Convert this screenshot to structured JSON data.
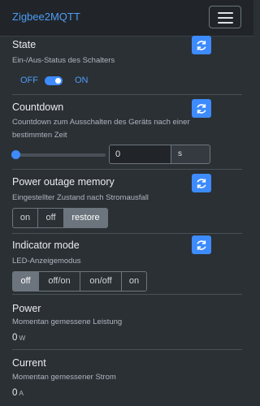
{
  "navbar": {
    "brand": "Zigbee2MQTT"
  },
  "state": {
    "title": "State",
    "description": "Ein-/Aus-Status des Schalters",
    "off_label": "OFF",
    "on_label": "ON",
    "is_on": true
  },
  "countdown": {
    "title": "Countdown",
    "description_line1": "Countdown zum Ausschalten des Geräts nach einer",
    "description_line2": "bestimmten Zeit",
    "value": "0",
    "unit": "s",
    "slider_level": 0
  },
  "power_outage": {
    "title": "Power outage memory",
    "description": "Eingestellter Zustand nach Stromausfall",
    "options": [
      "on",
      "off",
      "restore"
    ],
    "selected": "restore"
  },
  "indicator": {
    "title": "Indicator mode",
    "description": "LED-Anzeigemodus",
    "options": [
      "off",
      "off/on",
      "on/off",
      "on"
    ],
    "selected": "off"
  },
  "power": {
    "title": "Power",
    "description": "Momentan gemessene Leistung",
    "value": "0",
    "unit": "W"
  },
  "current": {
    "title": "Current",
    "description": "Momentan gemessener Strom",
    "value": "0",
    "unit": "A"
  },
  "colors": {
    "accent": "#3d8bfd",
    "background": "#2b3035",
    "navbar": "#212529"
  },
  "icons": {
    "refresh": "refresh-icon",
    "menu": "hamburger-menu-icon"
  }
}
